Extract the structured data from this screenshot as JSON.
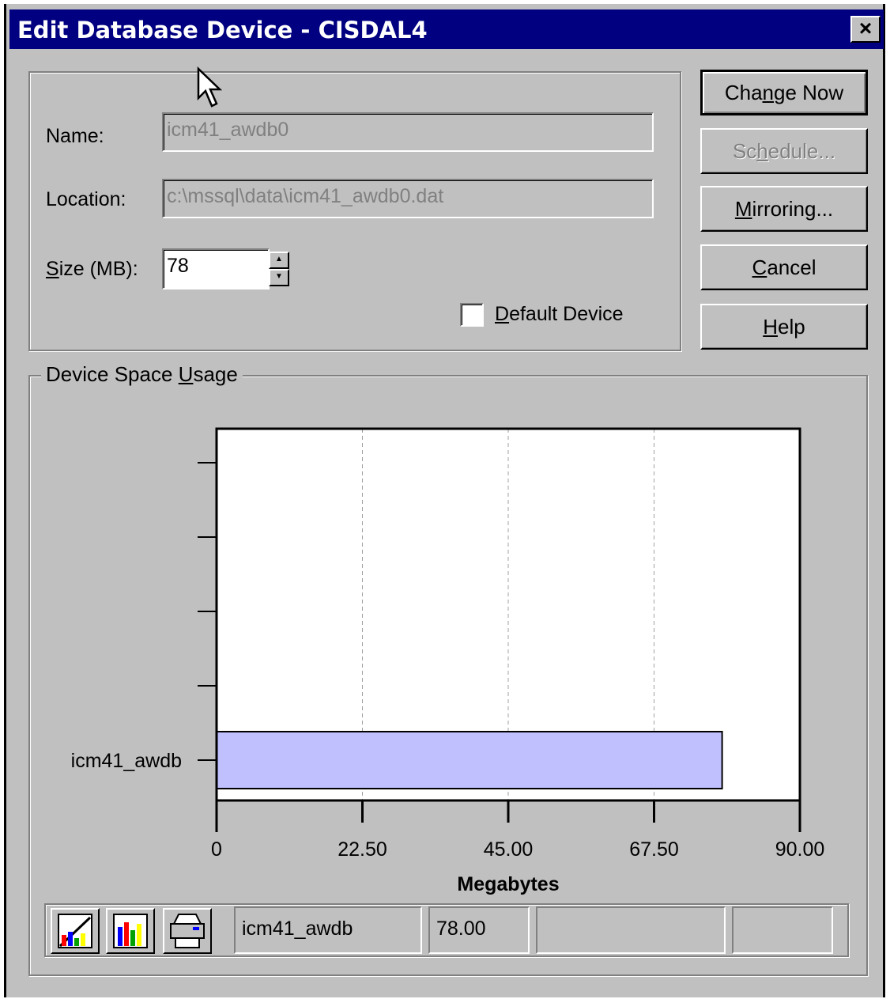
{
  "window": {
    "title": "Edit Database Device - CISDAL4",
    "close_label": "×"
  },
  "form": {
    "name_label": "Name:",
    "name_value": "icm41_awdb0",
    "location_label": "Location:",
    "location_value": "c:\\mssql\\data\\icm41_awdb0.dat",
    "size_label_accel": "S",
    "size_label_rest": "ize (MB):",
    "size_value": "78",
    "default_device_accel": "D",
    "default_device_rest": "efault Device",
    "default_device_checked": false
  },
  "buttons": {
    "change_now": {
      "pre": "Cha",
      "accel": "n",
      "post": "ge Now"
    },
    "schedule": {
      "pre": "Sc",
      "accel": "h",
      "post": "edule..."
    },
    "mirroring": {
      "pre": "",
      "accel": "M",
      "post": "irroring..."
    },
    "cancel": {
      "pre": "",
      "accel": "C",
      "post": "ancel"
    },
    "help": {
      "pre": "",
      "accel": "H",
      "post": "elp"
    }
  },
  "usage": {
    "group_pre": "Device Space ",
    "group_accel": "U",
    "group_post": "sage"
  },
  "chart_data": {
    "type": "bar",
    "orientation": "horizontal",
    "categories": [
      "icm41_awdb"
    ],
    "values": [
      78
    ],
    "xlabel": "Megabytes",
    "xlim": [
      0,
      90
    ],
    "x_ticks": [
      "0",
      "22.50",
      "45.00",
      "67.50",
      "90.00"
    ],
    "grid": true,
    "bar_color": "#c0c0ff"
  },
  "statusbar": {
    "icons": [
      "chart-type-icon",
      "bar-chart-icon",
      "print-icon"
    ],
    "name": "icm41_awdb",
    "value": "78.00"
  }
}
